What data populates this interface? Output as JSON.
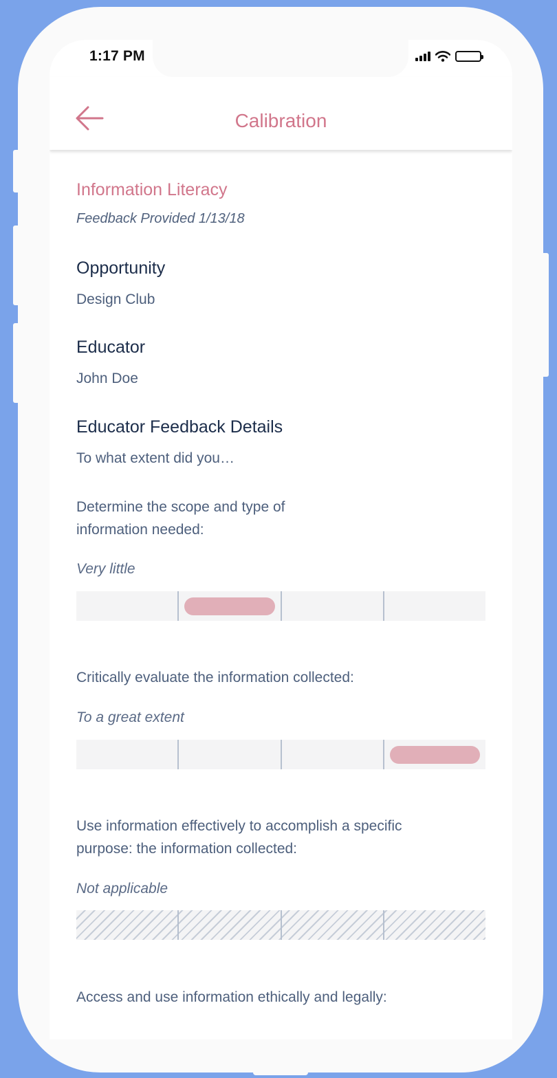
{
  "status_bar": {
    "time": "1:17 PM",
    "icons": [
      "signal-icon",
      "wifi-icon",
      "battery-icon"
    ]
  },
  "header": {
    "title": "Calibration",
    "back_icon": "arrow-left-icon"
  },
  "colors": {
    "accent": "#d1768b",
    "selected_pill": "#e1afb8",
    "background": "#7aa3ea",
    "heading": "#1c2d4a",
    "body_text": "#4d5f7c"
  },
  "skill": {
    "title": "Information Literacy",
    "feedback_date": "Feedback Provided 1/13/18"
  },
  "opportunity": {
    "label": "Opportunity",
    "value": "Design Club"
  },
  "educator": {
    "label": "Educator",
    "value": "John Doe"
  },
  "feedback": {
    "label": "Educator Feedback Details",
    "prompt": "To what extent did you…",
    "scale_levels": 4,
    "items": [
      {
        "question": "Determine the scope and type of information needed:",
        "answer": "Very little",
        "selected_level": 2
      },
      {
        "question": "Critically evaluate the information collected:",
        "answer": "To a great extent",
        "selected_level": 4
      },
      {
        "question": "Use information effectively to accomplish a specific purpose: the information collected:",
        "answer": "Not applicable",
        "selected_level": null
      },
      {
        "question": "Access and use information ethically and legally:",
        "answer": "",
        "selected_level": null
      }
    ]
  }
}
